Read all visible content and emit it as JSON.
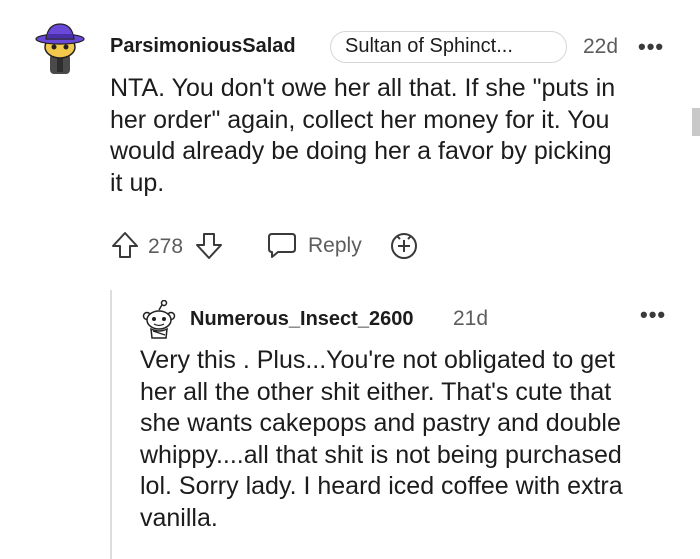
{
  "comment": {
    "username": "ParsimoniousSalad",
    "flair": "Sultan of Sphinct...",
    "age": "22d",
    "more": "•••",
    "lines": [
      "NTA. You don't owe her all that. If she \"puts in",
      "her order\" again, collect her money for it. You",
      "would already be doing her a favor by picking",
      "it up."
    ],
    "votes": "278",
    "reply_label": "Reply"
  },
  "reply": {
    "username": "Numerous_Insect_2600",
    "age": "21d",
    "more": "•••",
    "lines": [
      "Very this . Plus...You're not obligated to get",
      "her all the other shit either. That's cute that",
      "she wants cakepops and pastry and double",
      "whippy....all that shit is not being purchased",
      "lol. Sorry lady. I heard iced coffee with extra",
      "vanilla."
    ]
  },
  "colors": {
    "avatar_hat": "#6b49d8",
    "avatar_face": "#f2c94c",
    "text": "#1c1c1c",
    "muted": "#5c5c5c"
  },
  "icons": {
    "avatar1": "purple-hat-avatar-icon",
    "avatar2": "snoo-avatar-icon",
    "upvote": "upvote-arrow-icon",
    "downvote": "downvote-arrow-icon",
    "reply": "speech-bubble-icon",
    "award": "award-plus-icon"
  }
}
